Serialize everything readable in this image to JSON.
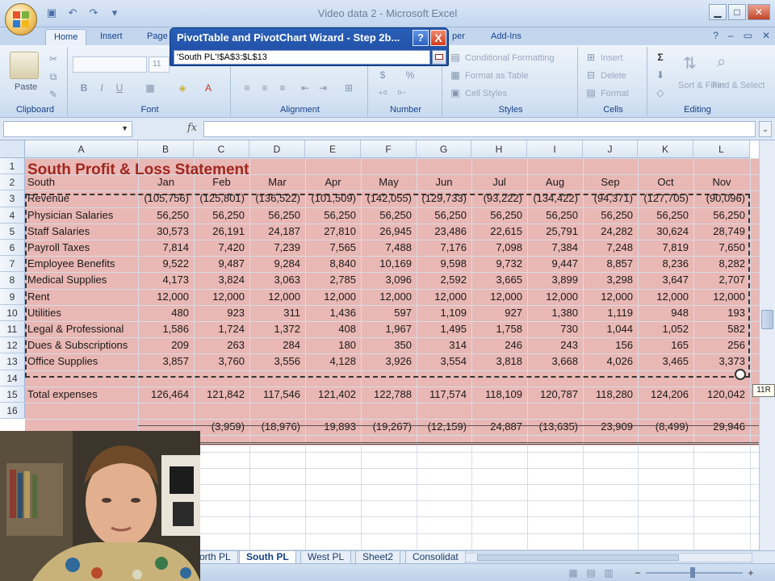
{
  "window": {
    "title": "Video data 2 - Microsoft Excel"
  },
  "ribbon": {
    "tabs": [
      "Home",
      "Insert",
      "Page",
      "per",
      "Add-Ins"
    ],
    "font_size": "11",
    "groups": {
      "clipboard": "Clipboard",
      "font": "Font",
      "alignment": "Alignment",
      "number": "Number",
      "styles": "Styles",
      "cells": "Cells",
      "editing": "Editing"
    },
    "buttons": {
      "paste": "Paste",
      "conditional_formatting": "Conditional Formatting",
      "format_as_table": "Format as Table",
      "cell_styles": "Cell Styles",
      "insert": "Insert",
      "delete": "Delete",
      "format": "Format",
      "sort_filter": "Sort & Filter",
      "find_select": "Find & Select",
      "number_dollar": "$",
      "number_percent": "%",
      "sum": "Σ",
      "bold": "B",
      "italic": "I",
      "underline": "U"
    }
  },
  "formula_bar": {
    "fx": "fx",
    "name_box": "",
    "formula": ""
  },
  "wizard": {
    "title": "PivotTable and PivotChart Wizard - Step 2b...",
    "help": "?",
    "close": "X",
    "range_value": "'South PL'!$A$3:$L$13"
  },
  "sheet": {
    "title": "South Profit & Loss Statement",
    "columns": [
      "A",
      "B",
      "C",
      "D",
      "E",
      "F",
      "G",
      "H",
      "I",
      "J",
      "K",
      "L"
    ],
    "row_numbers": [
      "1",
      "2",
      "3",
      "4",
      "5",
      "6",
      "7",
      "8",
      "9",
      "10",
      "11",
      "12",
      "13",
      "14",
      "15",
      "16"
    ],
    "header_label": "South",
    "months": [
      "Jan",
      "Feb",
      "Mar",
      "Apr",
      "May",
      "Jun",
      "Jul",
      "Aug",
      "Sep",
      "Oct",
      "Nov"
    ],
    "rows": [
      {
        "label": "Revenue",
        "values": [
          "(105,756)",
          "(125,801)",
          "(136,522)",
          "(101,509)",
          "(142,055)",
          "(129,733)",
          "(93,222)",
          "(134,422)",
          "(94,371)",
          "(127,705)",
          "(90,096)"
        ]
      },
      {
        "label": "Physician Salaries",
        "values": [
          "56,250",
          "56,250",
          "56,250",
          "56,250",
          "56,250",
          "56,250",
          "56,250",
          "56,250",
          "56,250",
          "56,250",
          "56,250"
        ]
      },
      {
        "label": "Staff Salaries",
        "values": [
          "30,573",
          "26,191",
          "24,187",
          "27,810",
          "26,945",
          "23,486",
          "22,615",
          "25,791",
          "24,282",
          "30,624",
          "28,749"
        ]
      },
      {
        "label": "Payroll Taxes",
        "values": [
          "7,814",
          "7,420",
          "7,239",
          "7,565",
          "7,488",
          "7,176",
          "7,098",
          "7,384",
          "7,248",
          "7,819",
          "7,650"
        ]
      },
      {
        "label": "Employee Benefits",
        "values": [
          "9,522",
          "9,487",
          "9,284",
          "8,840",
          "10,169",
          "9,598",
          "9,732",
          "9,447",
          "8,857",
          "8,236",
          "8,282"
        ]
      },
      {
        "label": "Medical Supplies",
        "values": [
          "4,173",
          "3,824",
          "3,063",
          "2,785",
          "3,096",
          "2,592",
          "3,665",
          "3,899",
          "3,298",
          "3,647",
          "2,707"
        ]
      },
      {
        "label": "Rent",
        "values": [
          "12,000",
          "12,000",
          "12,000",
          "12,000",
          "12,000",
          "12,000",
          "12,000",
          "12,000",
          "12,000",
          "12,000",
          "12,000"
        ]
      },
      {
        "label": "Utilities",
        "values": [
          "480",
          "923",
          "311",
          "1,436",
          "597",
          "1,109",
          "927",
          "1,380",
          "1,119",
          "948",
          "193"
        ]
      },
      {
        "label": "Legal & Professional",
        "values": [
          "1,586",
          "1,724",
          "1,372",
          "408",
          "1,967",
          "1,495",
          "1,758",
          "730",
          "1,044",
          "1,052",
          "582"
        ]
      },
      {
        "label": "Dues & Subscriptions",
        "values": [
          "209",
          "263",
          "284",
          "180",
          "350",
          "314",
          "246",
          "243",
          "156",
          "165",
          "256"
        ]
      },
      {
        "label": "Office Supplies",
        "values": [
          "3,857",
          "3,760",
          "3,556",
          "4,128",
          "3,926",
          "3,554",
          "3,818",
          "3,668",
          "4,026",
          "3,465",
          "3,373"
        ]
      }
    ],
    "total_label": "Total expenses",
    "totals": [
      "126,464",
      "121,842",
      "117,546",
      "121,402",
      "122,788",
      "117,574",
      "118,109",
      "120,787",
      "118,280",
      "124,206",
      "120,042"
    ],
    "net_visible": [
      "(3,959)",
      "(18,976)",
      "19,893",
      "(19,267)",
      "(12,159)",
      "24,887",
      "(13,635)",
      "23,909",
      "(8,499)",
      "29,946"
    ]
  },
  "tooltip": "11R",
  "sheet_tabs": [
    "orth PL",
    "South PL",
    "West PL",
    "Sheet2",
    "Consolidat"
  ],
  "colors": {
    "title_red": "#a0281f",
    "selection_pink": "#e9b7b4",
    "excel_blue": "#15428b"
  }
}
